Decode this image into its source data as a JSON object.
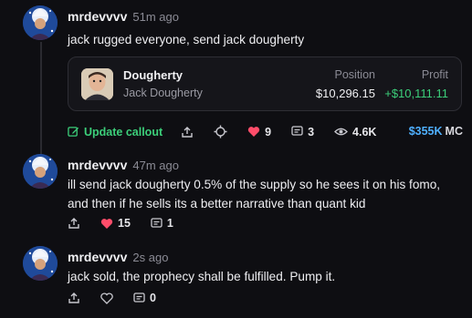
{
  "posts": [
    {
      "username": "mrdevvvv",
      "time": "51m ago",
      "text": "jack rugged everyone, send jack dougherty",
      "card": {
        "name": "Dougherty",
        "subtitle": "Jack Dougherty",
        "position_label": "Position",
        "position_value": "$10,296.15",
        "profit_label": "Profit",
        "profit_value": "+$10,111.11"
      },
      "update_label": "Update callout",
      "likes": "9",
      "comments": "3",
      "views": "4.6K",
      "market_cap": "$355K",
      "market_cap_unit": "MC"
    },
    {
      "username": "mrdevvvv",
      "time": "47m ago",
      "text": "ill send jack dougherty 0.5% of the supply so he sees it on his fomo, and then if he sells its a better narrative than quant kid",
      "likes": "15",
      "comments": "1"
    },
    {
      "username": "mrdevvvv",
      "time": "2s ago",
      "text": "jack sold, the prophecy shall be fulfilled. Pump it.",
      "comments": "0"
    }
  ],
  "colors": {
    "background": "#0e0e12",
    "accent_green": "#3ccf7a",
    "like_red": "#ff4d6a",
    "mc_blue": "#4fb0ff"
  },
  "icons": [
    "share-icon",
    "crosshair-icon",
    "heart-icon",
    "comment-icon",
    "eye-icon",
    "edit-icon"
  ]
}
